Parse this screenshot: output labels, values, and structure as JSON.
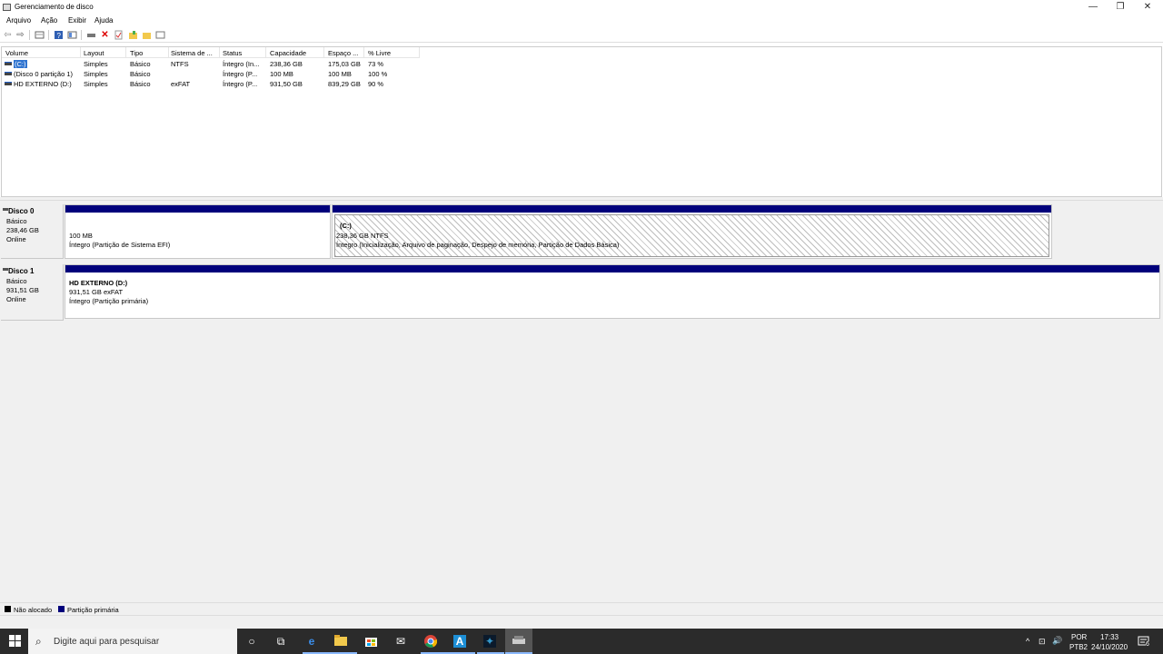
{
  "window": {
    "title": "Gerenciamento de disco",
    "minimize": "—",
    "maximize": "❐",
    "close": "✕"
  },
  "menu": [
    "Arquivo",
    "Ação",
    "Exibir",
    "Ajuda"
  ],
  "volume_list": {
    "columns": [
      "Volume",
      "Layout",
      "Tipo",
      "Sistema de ...",
      "Status",
      "Capacidade",
      "Espaço ...",
      "% Livre"
    ],
    "rows": [
      {
        "volume": "(C:)",
        "layout": "Simples",
        "tipo": "Básico",
        "sistema": "NTFS",
        "status": "Íntegro (In...",
        "capacidade": "238,36 GB",
        "espaco": "175,03 GB",
        "livre": "73 %"
      },
      {
        "volume": "(Disco 0 partição 1)",
        "layout": "Simples",
        "tipo": "Básico",
        "sistema": "",
        "status": "Íntegro (P...",
        "capacidade": "100 MB",
        "espaco": "100 MB",
        "livre": "100 %"
      },
      {
        "volume": "HD EXTERNO  (D:)",
        "layout": "Simples",
        "tipo": "Básico",
        "sistema": "exFAT",
        "status": "Íntegro (P...",
        "capacidade": "931,50 GB",
        "espaco": "839,29 GB",
        "livre": "90 %"
      }
    ]
  },
  "disks": [
    {
      "name": "Disco 0",
      "type": "Básico",
      "size": "238,46 GB",
      "state": "Online",
      "partitions": [
        {
          "title": "",
          "line1": "100 MB",
          "line2": "Íntegro (Partição de Sistema EFI)"
        },
        {
          "title": "(C:)",
          "line1": "238,36 GB NTFS",
          "line2": "Íntegro (Inicialização, Arquivo de paginação, Despejo de memória, Partição de Dados Básica)"
        }
      ]
    },
    {
      "name": "Disco 1",
      "type": "Básico",
      "size": "931,51 GB",
      "state": "Online",
      "partitions": [
        {
          "title": "HD EXTERNO  (D:)",
          "line1": "931,51 GB exFAT",
          "line2": "Íntegro (Partição primária)"
        }
      ]
    }
  ],
  "legend": [
    {
      "label": "Não alocado",
      "color": "#000000"
    },
    {
      "label": "Partição primária",
      "color": "#00007b"
    }
  ],
  "taskbar": {
    "search_placeholder": "Digite aqui para pesquisar",
    "lang_top": "POR",
    "lang_bottom": "PTB2",
    "time": "17:33",
    "date": "24/10/2020",
    "notification_count": "6",
    "tray_icons": [
      "^",
      "⊡",
      "🔊"
    ]
  },
  "colors": {
    "primary_partition": "#00007b",
    "selection": "#2f74d0",
    "taskbar": "#2b2b2b"
  }
}
